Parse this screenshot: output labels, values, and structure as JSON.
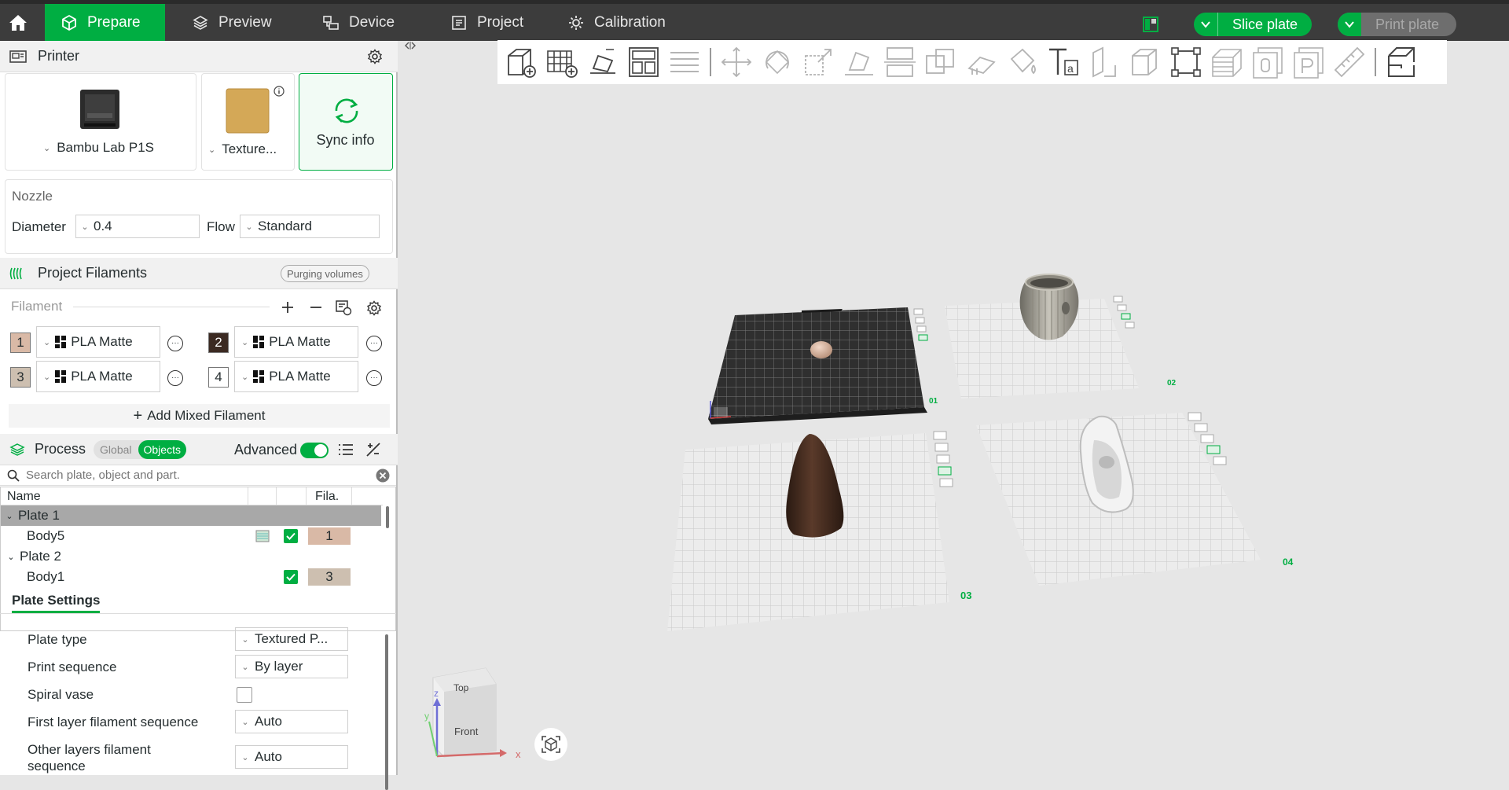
{
  "tabs": [
    {
      "label": "Prepare"
    },
    {
      "label": "Preview"
    },
    {
      "label": "Device"
    },
    {
      "label": "Project"
    },
    {
      "label": "Calibration"
    }
  ],
  "topbar": {
    "slice_label": "Slice plate",
    "print_label": "Print plate"
  },
  "printer": {
    "header": "Printer",
    "printer_name": "Bambu Lab P1S",
    "plate_name": "Texture...",
    "sync_label": "Sync info"
  },
  "nozzle": {
    "title": "Nozzle",
    "diameter_label": "Diameter",
    "diameter_value": "0.4",
    "flow_label": "Flow",
    "flow_value": "Standard"
  },
  "filaments": {
    "header": "Project Filaments",
    "purge_label": "Purging volumes",
    "filament_label": "Filament",
    "items": [
      {
        "num": "1",
        "name": "PLA Matte",
        "color": "#d9b9a6"
      },
      {
        "num": "2",
        "name": "PLA Matte",
        "color": "#3b2a22"
      },
      {
        "num": "3",
        "name": "PLA Matte",
        "color": "#cdbfb0"
      },
      {
        "num": "4",
        "name": "PLA Matte",
        "color": "#ffffff"
      }
    ],
    "add_mixed": "Add Mixed Filament"
  },
  "process": {
    "header": "Process",
    "global": "Global",
    "objects": "Objects",
    "advanced": "Advanced"
  },
  "search": {
    "placeholder": "Search plate, object and part."
  },
  "tree": {
    "col_name": "Name",
    "col_fila": "Fila.",
    "rows": [
      {
        "label": "Plate 1",
        "fila": ""
      },
      {
        "label": "Body5",
        "fila": "1"
      },
      {
        "label": "Plate 2",
        "fila": ""
      },
      {
        "label": "Body1",
        "fila": "3"
      }
    ]
  },
  "plate_settings": {
    "title": "Plate Settings",
    "rows": [
      {
        "label": "Plate type",
        "value": "Textured P..."
      },
      {
        "label": "Print sequence",
        "value": "By layer"
      },
      {
        "label": "Spiral vase",
        "value": ""
      },
      {
        "label": "First layer filament sequence",
        "value": "Auto"
      },
      {
        "label": "Other layers filament",
        "label2": "sequence",
        "value": "Auto"
      }
    ]
  },
  "viewport": {
    "plate_labels": [
      "01",
      "02",
      "03",
      "04"
    ],
    "cube_top": "Top",
    "cube_front": "Front",
    "axis_x": "x",
    "axis_y": "y",
    "axis_z": "z"
  },
  "colors": {
    "accent": "#00ae42",
    "topbar": "#3c3c3c"
  }
}
